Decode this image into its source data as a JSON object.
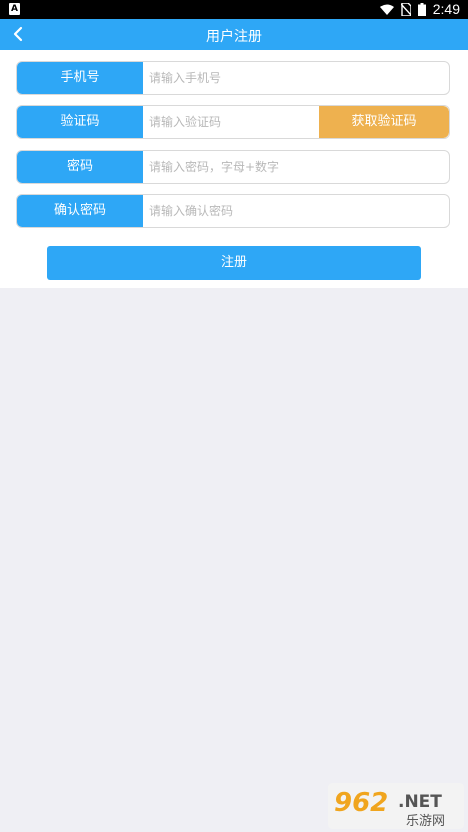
{
  "status_bar": {
    "time": "2:49",
    "notification_icon": "A"
  },
  "app_bar": {
    "title": "用户注册",
    "back_icon": "chevron-left-icon"
  },
  "form": {
    "phone": {
      "label": "手机号",
      "placeholder": "请输入手机号"
    },
    "code": {
      "label": "验证码",
      "placeholder": "请输入验证码",
      "button": "获取验证码"
    },
    "password": {
      "label": "密码",
      "placeholder": "请输入密码，字母+数字"
    },
    "confirm": {
      "label": "确认密码",
      "placeholder": "请输入确认密码"
    },
    "submit": "注册"
  },
  "watermark": {
    "text": "962.NET",
    "subtext": "乐游网"
  },
  "colors": {
    "primary": "#2ea7f6",
    "code_button": "#eeb14f",
    "background": "#efeff4"
  }
}
